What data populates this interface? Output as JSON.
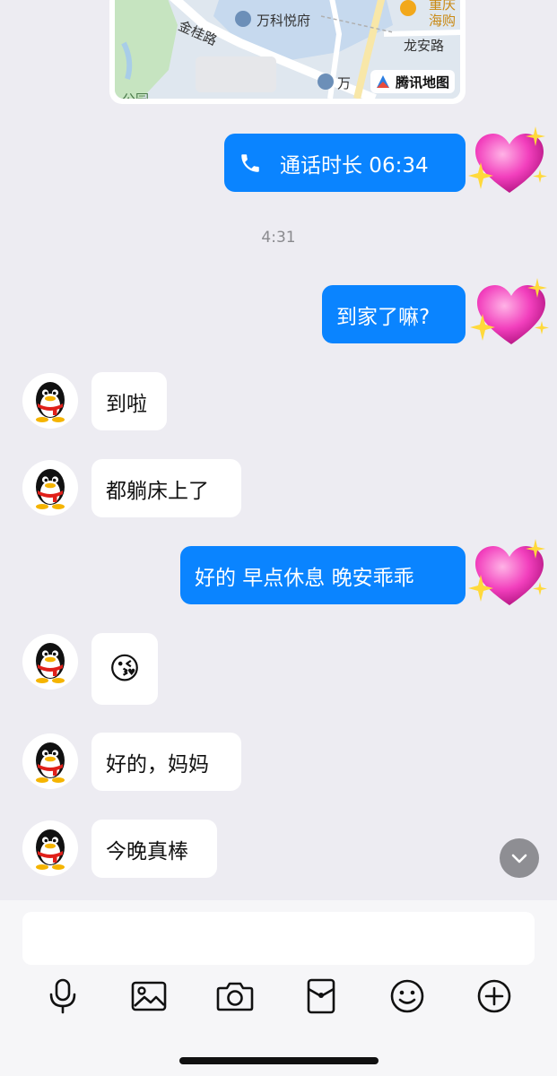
{
  "map": {
    "labels": {
      "road_jingui": "金桂路",
      "place_wanke": "万科悦府",
      "place_chongqing": "重庆",
      "place_haigou": "海购",
      "road_longan": "龙安路",
      "place_wan_partial": "万",
      "park_partial": "公园"
    },
    "brand": "腾讯地图"
  },
  "messages": [
    {
      "type": "call",
      "direction": "sent",
      "text": "通话时长 06:34",
      "icon": "phone-icon"
    },
    {
      "type": "timestamp",
      "text": "4:31"
    },
    {
      "type": "text",
      "direction": "sent",
      "text": "到家了嘛?"
    },
    {
      "type": "text",
      "direction": "received",
      "text": "到啦"
    },
    {
      "type": "text",
      "direction": "received",
      "text": "都躺床上了"
    },
    {
      "type": "text",
      "direction": "sent",
      "text": "好的 早点休息 晚安乖乖"
    },
    {
      "type": "emoji",
      "direction": "received",
      "text": "😘"
    },
    {
      "type": "text",
      "direction": "received",
      "text": "好的，妈妈"
    },
    {
      "type": "text",
      "direction": "received",
      "text": "今晚真棒"
    }
  ],
  "input": {
    "placeholder": ""
  },
  "toolbar": [
    "mic-icon",
    "image-icon",
    "camera-icon",
    "red-packet-icon",
    "emoji-icon",
    "plus-icon"
  ],
  "colors": {
    "sent_bubble": "#0a84ff",
    "received_bubble": "#ffffff",
    "background": "#edecf2"
  }
}
